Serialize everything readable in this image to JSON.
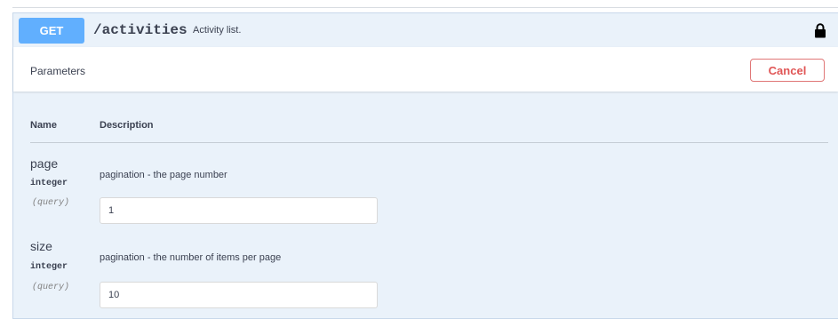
{
  "operation": {
    "method": "GET",
    "path": "/activities",
    "summary": "Activity list.",
    "lock_icon": "lock-icon"
  },
  "parameters_section": {
    "title": "Parameters",
    "cancel_label": "Cancel",
    "columns": {
      "name": "Name",
      "description": "Description"
    }
  },
  "parameters": [
    {
      "name": "page",
      "type": "integer",
      "in": "(query)",
      "description": "pagination - the page number",
      "value": "1"
    },
    {
      "name": "size",
      "type": "integer",
      "in": "(query)",
      "description": "pagination - the number of items per page",
      "value": "10"
    }
  ],
  "colors": {
    "get_method": "#61affe",
    "block_background": "#eaf2fa",
    "cancel_border": "#e07777"
  }
}
